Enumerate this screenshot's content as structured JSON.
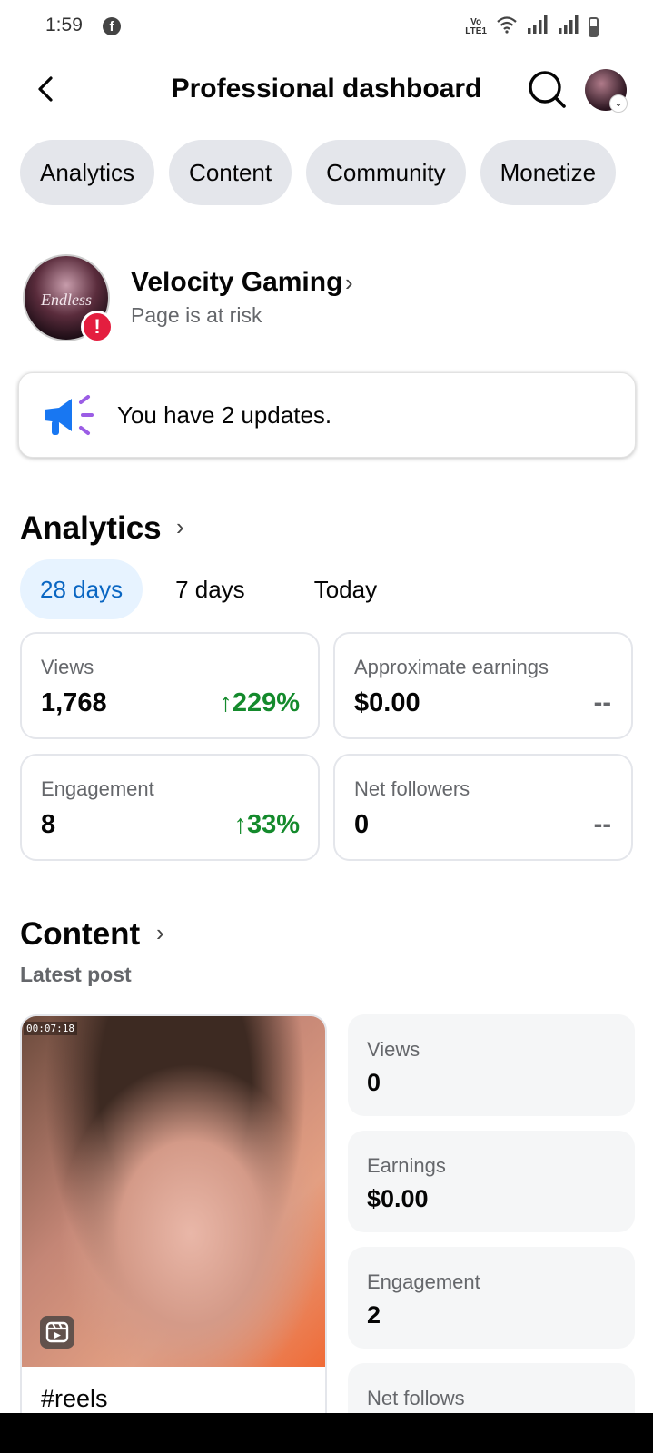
{
  "status_bar": {
    "time": "1:59",
    "facebook_glyph": "f",
    "volte_label": "Vo))\nLTE1"
  },
  "header": {
    "title": "Professional dashboard"
  },
  "tabs": [
    {
      "label": "Analytics"
    },
    {
      "label": "Content"
    },
    {
      "label": "Community"
    },
    {
      "label": "Monetize"
    }
  ],
  "page": {
    "name": "Velocity Gaming",
    "status": "Page is at risk",
    "avatar_text": "Endless",
    "badge": "!"
  },
  "updates": {
    "text": "You have 2 updates."
  },
  "analytics": {
    "title": "Analytics",
    "ranges": [
      {
        "label": "28 days",
        "active": true
      },
      {
        "label": "7 days",
        "active": false
      },
      {
        "label": "Today",
        "active": false
      }
    ],
    "metrics": [
      {
        "label": "Views",
        "value": "1,768",
        "change": "229%"
      },
      {
        "label": "Approximate earnings",
        "value": "$0.00",
        "change": "--"
      },
      {
        "label": "Engagement",
        "value": "8",
        "change": "33%"
      },
      {
        "label": "Net followers",
        "value": "0",
        "change": "--"
      }
    ]
  },
  "content": {
    "title": "Content",
    "subtitle": "Latest post",
    "post": {
      "timestamp": "00:07:18",
      "caption": "#reels"
    },
    "stats": [
      {
        "label": "Views",
        "value": "0"
      },
      {
        "label": "Earnings",
        "value": "$0.00"
      },
      {
        "label": "Engagement",
        "value": "2"
      },
      {
        "label": "Net follows",
        "value": ""
      }
    ]
  },
  "colors": {
    "accent_blue": "#0a66c2",
    "positive_green": "#148a2c",
    "alert_red": "#e41e3f",
    "chip_gray": "#e4e6eb"
  }
}
